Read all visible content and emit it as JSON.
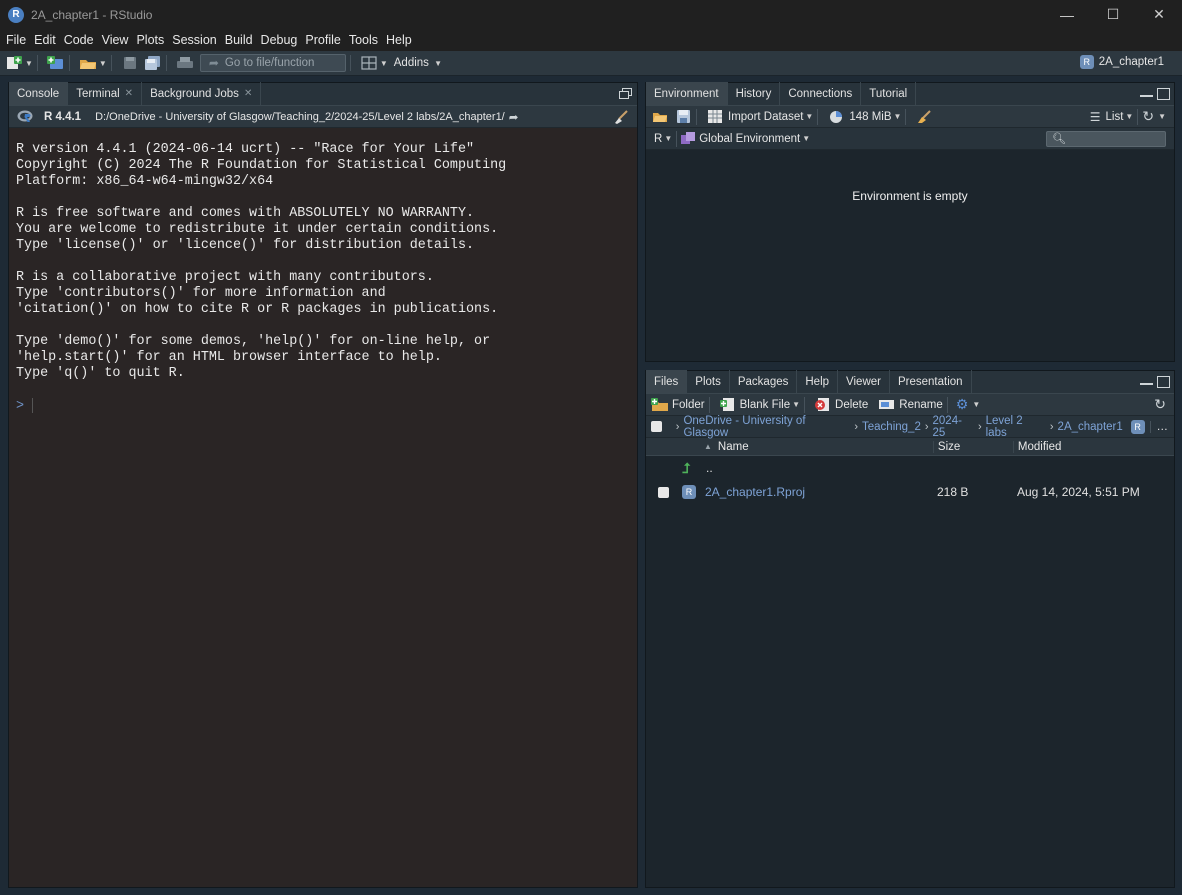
{
  "window": {
    "logo": "R",
    "title": "2A_chapter1 - RStudio",
    "controls": {
      "minimize": "—",
      "maximize": "☐",
      "close": "✕"
    }
  },
  "menu": [
    "File",
    "Edit",
    "Code",
    "View",
    "Plots",
    "Session",
    "Build",
    "Debug",
    "Profile",
    "Tools",
    "Help"
  ],
  "toolbar": {
    "goto_placeholder": "Go to file/function",
    "addins_label": "Addins",
    "project_label": "2A_chapter1"
  },
  "console_pane": {
    "tabs": [
      {
        "label": "Console",
        "active": true
      },
      {
        "label": "Terminal",
        "closable": true
      },
      {
        "label": "Background Jobs",
        "closable": true
      }
    ],
    "r_version": "R 4.4.1",
    "path": "D:/OneDrive - University of Glasgow/Teaching_2/2024-25/Level 2 labs/2A_chapter1/",
    "output": "R version 4.4.1 (2024-06-14 ucrt) -- \"Race for Your Life\"\nCopyright (C) 2024 The R Foundation for Statistical Computing\nPlatform: x86_64-w64-mingw32/x64\n\nR is free software and comes with ABSOLUTELY NO WARRANTY.\nYou are welcome to redistribute it under certain conditions.\nType 'license()' or 'licence()' for distribution details.\n\nR is a collaborative project with many contributors.\nType 'contributors()' for more information and\n'citation()' on how to cite R or R packages in publications.\n\nType 'demo()' for some demos, 'help()' for on-line help, or\n'help.start()' for an HTML browser interface to help.\nType 'q()' to quit R.",
    "prompt": ">"
  },
  "environment_pane": {
    "tabs": [
      {
        "label": "Environment",
        "active": true
      },
      {
        "label": "History"
      },
      {
        "label": "Connections"
      },
      {
        "label": "Tutorial"
      }
    ],
    "import_label": "Import Dataset",
    "memory_label": "148 MiB",
    "view_label": "List",
    "language_label": "R",
    "scope_label": "Global Environment",
    "empty_message": "Environment is empty"
  },
  "files_pane": {
    "tabs": [
      {
        "label": "Files",
        "active": true
      },
      {
        "label": "Plots"
      },
      {
        "label": "Packages"
      },
      {
        "label": "Help"
      },
      {
        "label": "Viewer"
      },
      {
        "label": "Presentation"
      }
    ],
    "actions": {
      "folder": "Folder",
      "blank_file": "Blank File",
      "delete": "Delete",
      "rename": "Rename"
    },
    "breadcrumb": [
      "OneDrive - University of Glasgow",
      "Teaching_2",
      "2024-25",
      "Level 2 labs",
      "2A_chapter1"
    ],
    "breadcrumb_more": "…",
    "columns": {
      "name": "Name",
      "size": "Size",
      "modified": "Modified"
    },
    "parent_label": "..",
    "files": [
      {
        "name": "2A_chapter1.Rproj",
        "size": "218 B",
        "modified": "Aug 14, 2024, 5:51 PM"
      }
    ]
  }
}
